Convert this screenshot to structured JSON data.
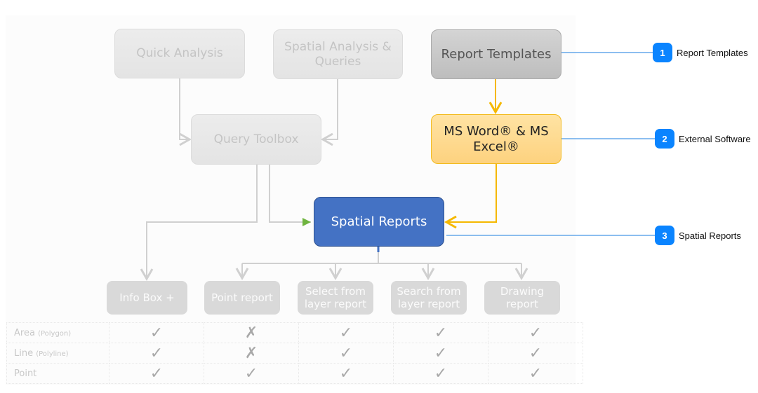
{
  "nodes": {
    "quick_analysis": "Quick Analysis",
    "spatial_analysis_line1": "Spatial Analysis &",
    "spatial_analysis_line2": "Queries",
    "query_toolbox": "Query Toolbox",
    "report_templates": "Report Templates",
    "ms_office_line1": "MS Word® & MS",
    "ms_office_line2": "Excel®",
    "spatial_reports": "Spatial Reports"
  },
  "report_types": [
    {
      "line1": "Info Box +",
      "line2": ""
    },
    {
      "line1": "Point report",
      "line2": ""
    },
    {
      "line1": "Select from",
      "line2": "layer report"
    },
    {
      "line1": "Search from",
      "line2": "layer report"
    },
    {
      "line1": "Drawing",
      "line2": "report"
    }
  ],
  "callouts": [
    {
      "number": "1",
      "label": "Report Templates"
    },
    {
      "number": "2",
      "label": "External Software"
    },
    {
      "number": "3",
      "label": "Spatial Reports"
    }
  ],
  "matrix": {
    "rows": [
      {
        "label": "Area",
        "sublabel": "(Polygon)",
        "values": [
          "✓",
          "✗",
          "✓",
          "✓",
          "✓"
        ]
      },
      {
        "label": "Line",
        "sublabel": "(Polyline)",
        "values": [
          "✓",
          "✗",
          "✓",
          "✓",
          "✓"
        ]
      },
      {
        "label": "Point",
        "sublabel": "",
        "values": [
          "✓",
          "✓",
          "✓",
          "✓",
          "✓"
        ]
      }
    ]
  },
  "colors": {
    "connector_gray": "#d0d0d0",
    "connector_yellow": "#f5b800",
    "callout_blue": "#0a84ff",
    "spatial_reports_fill": "#4472c4",
    "ms_office_fill": "#fdd680"
  }
}
